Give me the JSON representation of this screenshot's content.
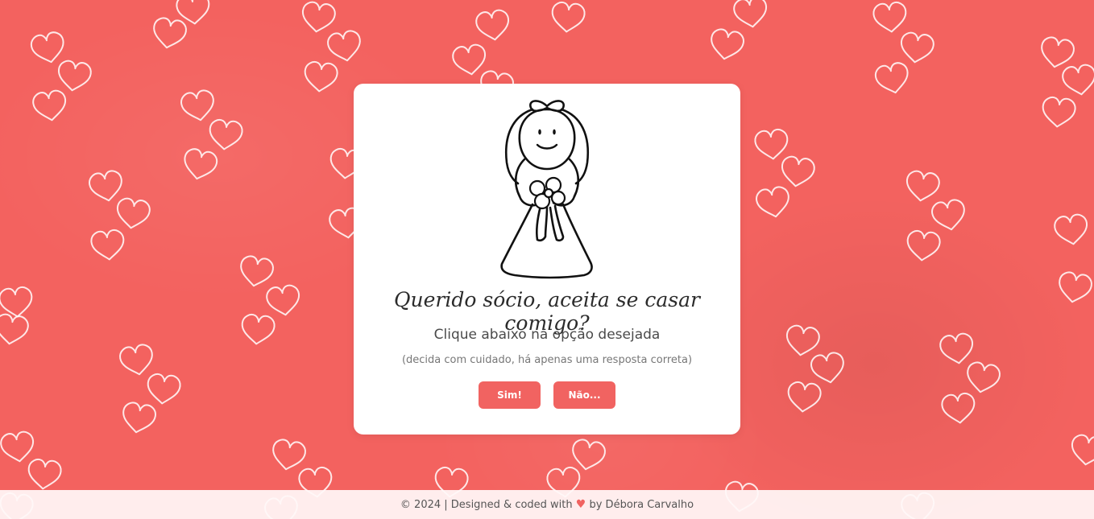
{
  "card": {
    "question": "Querido sócio, aceita se casar comigo?",
    "instruction": "Clique abaixo na opção desejada",
    "note": "(decida com cuidado, há apenas uma resposta correta)",
    "yes_label": "Sim!",
    "no_label": "Não..."
  },
  "footer": {
    "prefix": "© 2024 | Designed & coded with",
    "heart_icon": "heart-icon",
    "suffix": "by Débora Carvalho"
  },
  "colors": {
    "background": "#f3625f",
    "accent": "#f16361",
    "card": "#ffffff"
  }
}
